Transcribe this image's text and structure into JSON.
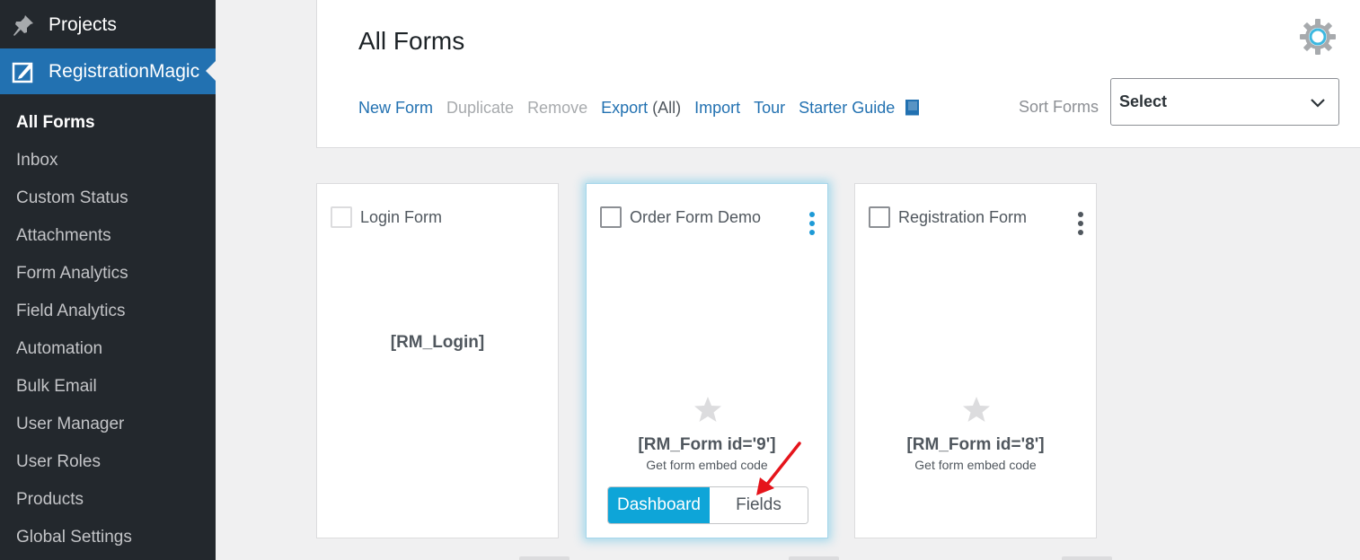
{
  "sidebar": {
    "projects": {
      "label": "Projects",
      "icon": "pin-icon"
    },
    "plugin": {
      "label": "RegistrationMagic",
      "icon": "edit-form-icon"
    },
    "items": [
      {
        "label": "All Forms"
      },
      {
        "label": "Inbox"
      },
      {
        "label": "Custom Status"
      },
      {
        "label": "Attachments"
      },
      {
        "label": "Form Analytics"
      },
      {
        "label": "Field Analytics"
      },
      {
        "label": "Automation"
      },
      {
        "label": "Bulk Email"
      },
      {
        "label": "User Manager"
      },
      {
        "label": "User Roles"
      },
      {
        "label": "Products"
      },
      {
        "label": "Global Settings"
      }
    ]
  },
  "header": {
    "title": "All Forms",
    "actions": {
      "new_form": "New Form",
      "duplicate": "Duplicate",
      "remove": "Remove",
      "export": "Export",
      "export_all": "(All)",
      "import": "Import",
      "tour": "Tour",
      "starter_guide": "Starter Guide"
    },
    "sort_label": "Sort Forms",
    "sort_value": "Select"
  },
  "cards": [
    {
      "title": "Login Form",
      "shortcode": "[RM_Login]"
    },
    {
      "title": "Order Form Demo",
      "shortcode": "[RM_Form id='9']",
      "embed": "Get form embed code",
      "dashboard": "Dashboard",
      "fields": "Fields"
    },
    {
      "title": "Registration Form",
      "shortcode": "[RM_Form id='8']",
      "embed": "Get form embed code"
    }
  ],
  "colors": {
    "sidebar_bg": "#23282d",
    "active_menu": "#2271b1",
    "link": "#2271b1",
    "dashboard_button": "#0ea5d8",
    "annotation_arrow": "#e5141b"
  }
}
